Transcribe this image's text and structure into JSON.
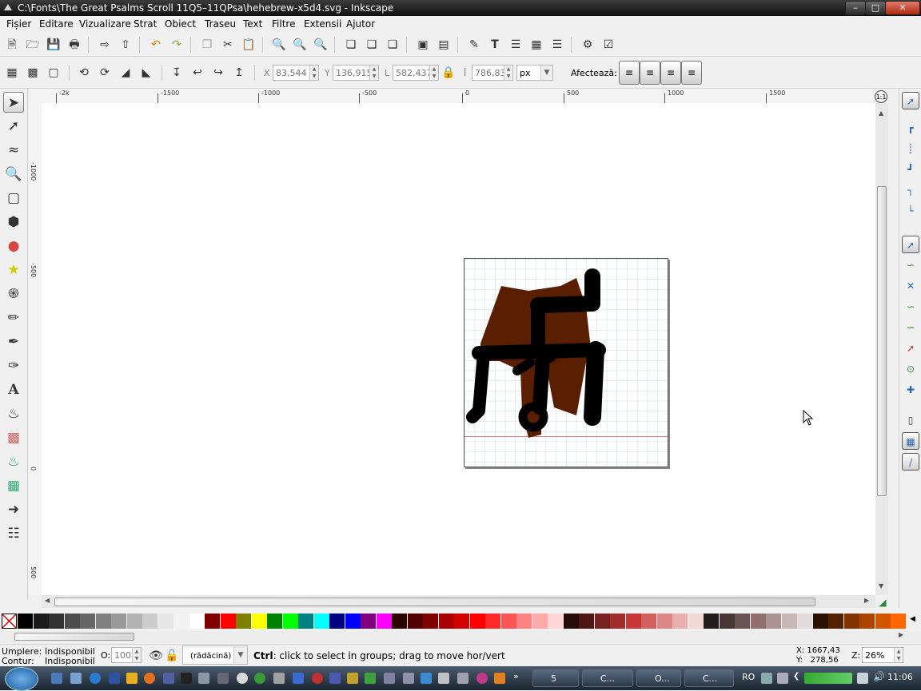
{
  "window": {
    "title": "C:\\Fonts\\The Great Psalms Scroll 11Q5–11QPsa\\hehebrew-x5d4.svg - Inkscape",
    "controls": {
      "minimize": "–",
      "maximize": "□",
      "close": "✕"
    }
  },
  "menu": {
    "items": [
      {
        "label": "Fișier"
      },
      {
        "label": "Editare"
      },
      {
        "label": "Vizualizare"
      },
      {
        "label": "Strat"
      },
      {
        "label": "Obiect"
      },
      {
        "label": "Traseu"
      },
      {
        "label": "Text"
      },
      {
        "label": "Filtre"
      },
      {
        "label": "Extensii"
      },
      {
        "label": "Ajutor"
      }
    ]
  },
  "controls": {
    "x_label": "X",
    "x_value": "83,544",
    "y_label": "Y",
    "y_value": "136,915",
    "w_label": "L",
    "w_value": "582,437",
    "h_label": "Î",
    "h_value": "786,831",
    "unit": "px",
    "affect_label": "Afectează:"
  },
  "ruler": {
    "h_labels": [
      "-2k",
      "-1500",
      "-1000",
      "-500",
      "0",
      "500",
      "1000",
      "1500"
    ],
    "v_labels": [
      "-1000",
      "-500",
      "0",
      "500"
    ]
  },
  "status": {
    "fill_label": "Umplere:",
    "fill_value": "Indisponibil",
    "stroke_label": "Contur:",
    "stroke_value": "Indisponibil",
    "opacity_label": "O:",
    "opacity_value": "100",
    "layer": "(rădăcină)",
    "message_key": "Ctrl",
    "message_rest": ": click to select in groups; drag to move hor/vert",
    "cursor_x": "X: 1667,43",
    "cursor_y": "Y:   278,56",
    "zoom_label": "Z:",
    "zoom_value": "26%"
  },
  "palette": {
    "colors": [
      "#000000",
      "#1a1a1a",
      "#333333",
      "#4d4d4d",
      "#666666",
      "#808080",
      "#999999",
      "#b3b3b3",
      "#cccccc",
      "#e6e6e6",
      "#f2f2f2",
      "#ffffff",
      "#800000",
      "#ff0000",
      "#808000",
      "#ffff00",
      "#008000",
      "#00ff00",
      "#008080",
      "#00ffff",
      "#000080",
      "#0000ff",
      "#800080",
      "#ff00ff",
      "#2b0000",
      "#550000",
      "#800000",
      "#aa0000",
      "#d40000",
      "#ff0000",
      "#ff2a2a",
      "#ff5555",
      "#ff8080",
      "#ffaaaa",
      "#ffd5d5",
      "#280b0b",
      "#501616",
      "#782121",
      "#a02c2c",
      "#c83737",
      "#d35f5f",
      "#de8787",
      "#e9afaf",
      "#f4d7d7",
      "#241c1c",
      "#483737",
      "#6c5353",
      "#916f6f",
      "#ac9393",
      "#c8b7b7",
      "#e3dbdb",
      "#2b1100",
      "#552200",
      "#803300",
      "#aa4400",
      "#d45500",
      "#ff6600"
    ]
  },
  "taskbar": {
    "items": [
      {
        "label": "5"
      },
      {
        "label": "C..."
      },
      {
        "label": "O..."
      },
      {
        "label": "C..."
      }
    ],
    "lang": "RO",
    "clock": "11:06"
  },
  "colors": {
    "glyph_black": "#000000",
    "glyph_brown": "#5a1e00",
    "grid": "#c8d8e8",
    "baseline": "#e08080"
  }
}
